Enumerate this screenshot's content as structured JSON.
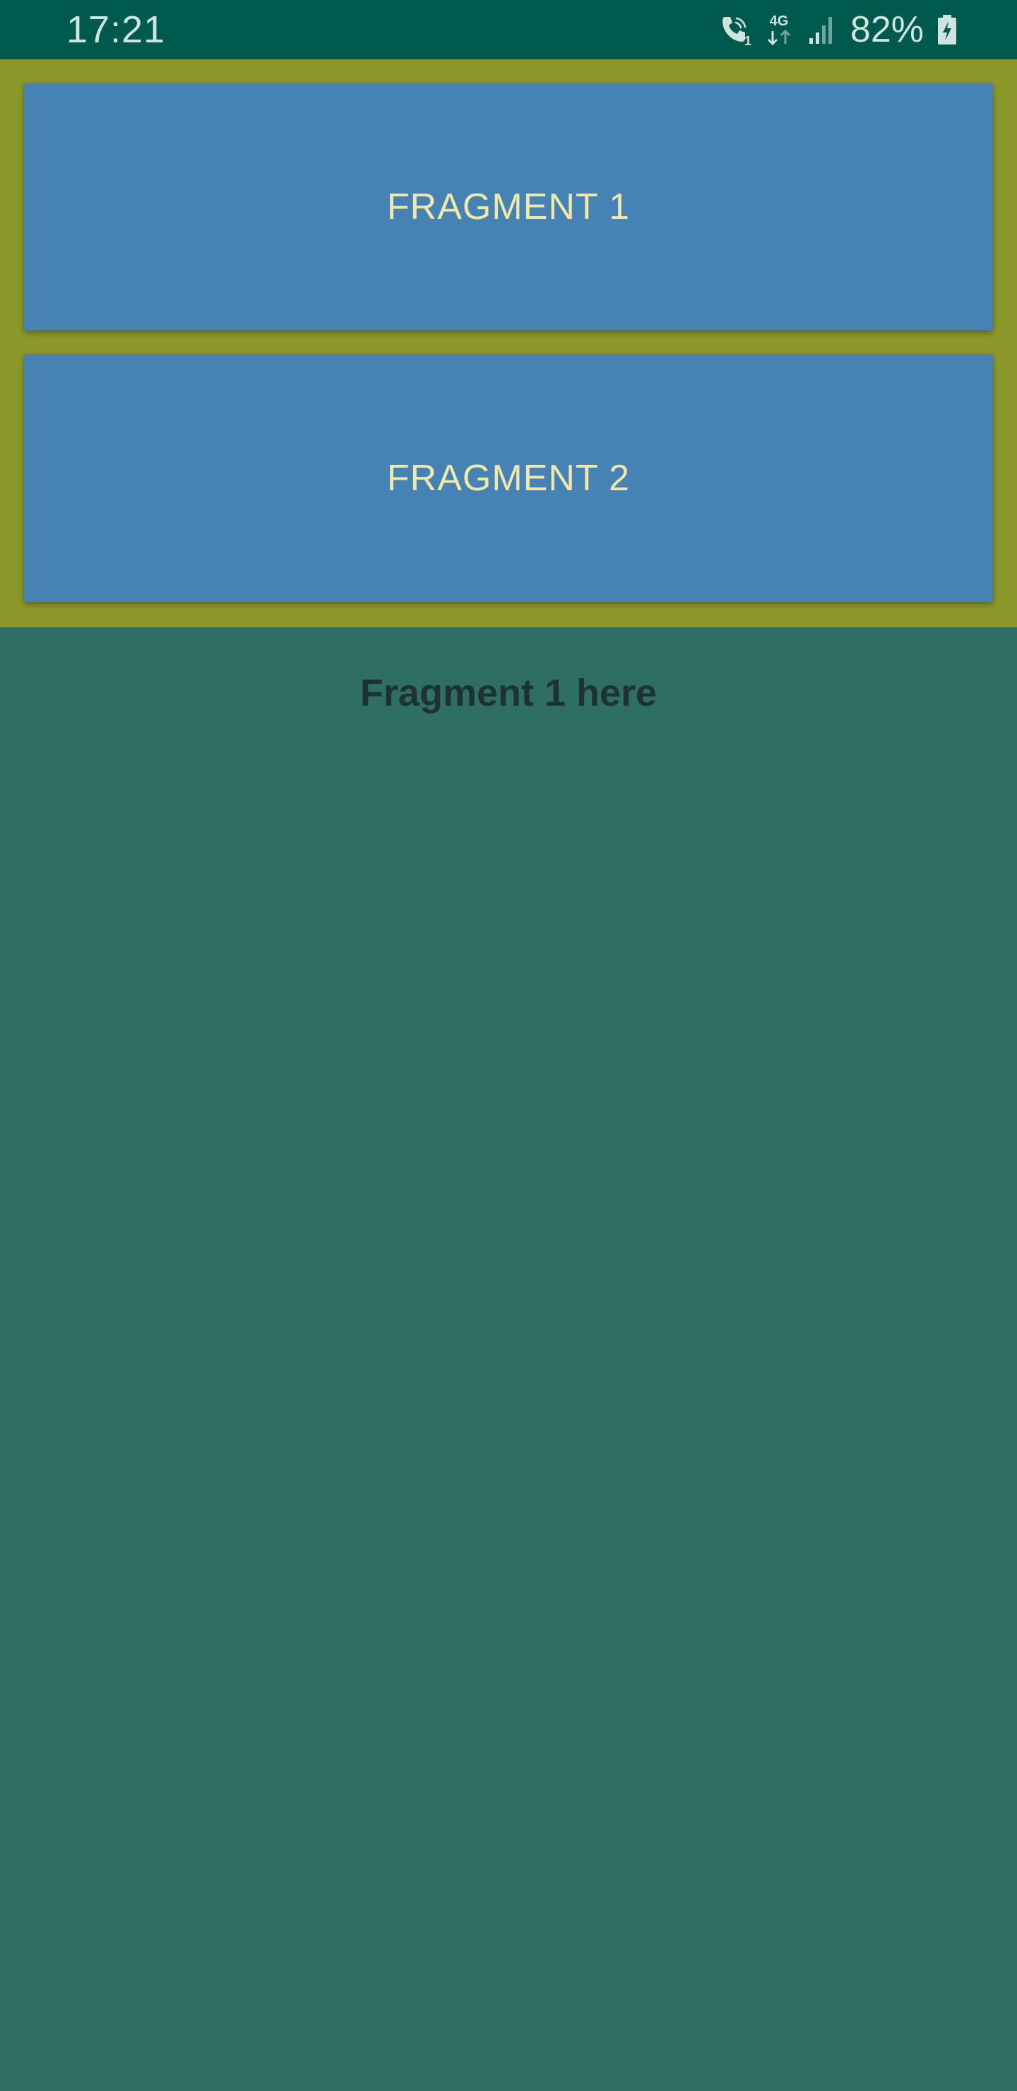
{
  "status_bar": {
    "time": "17:21",
    "network": "4G",
    "sim_slot": "1",
    "battery_percent": "82%",
    "icons": [
      "call-icon",
      "network-4g-icon",
      "signal-icon",
      "battery-charging-icon"
    ]
  },
  "buttons": {
    "fragment1_label": "FRAGMENT 1",
    "fragment2_label": "FRAGMENT 2"
  },
  "content": {
    "fragment_text": "Fragment 1 here"
  },
  "colors": {
    "status_bar_bg": "#00594d",
    "panel_bg": "#8b992b",
    "button_bg": "#4682b4",
    "button_text": "#eee8aa",
    "content_bg": "#2f6e65",
    "content_text": "#1c3330"
  }
}
